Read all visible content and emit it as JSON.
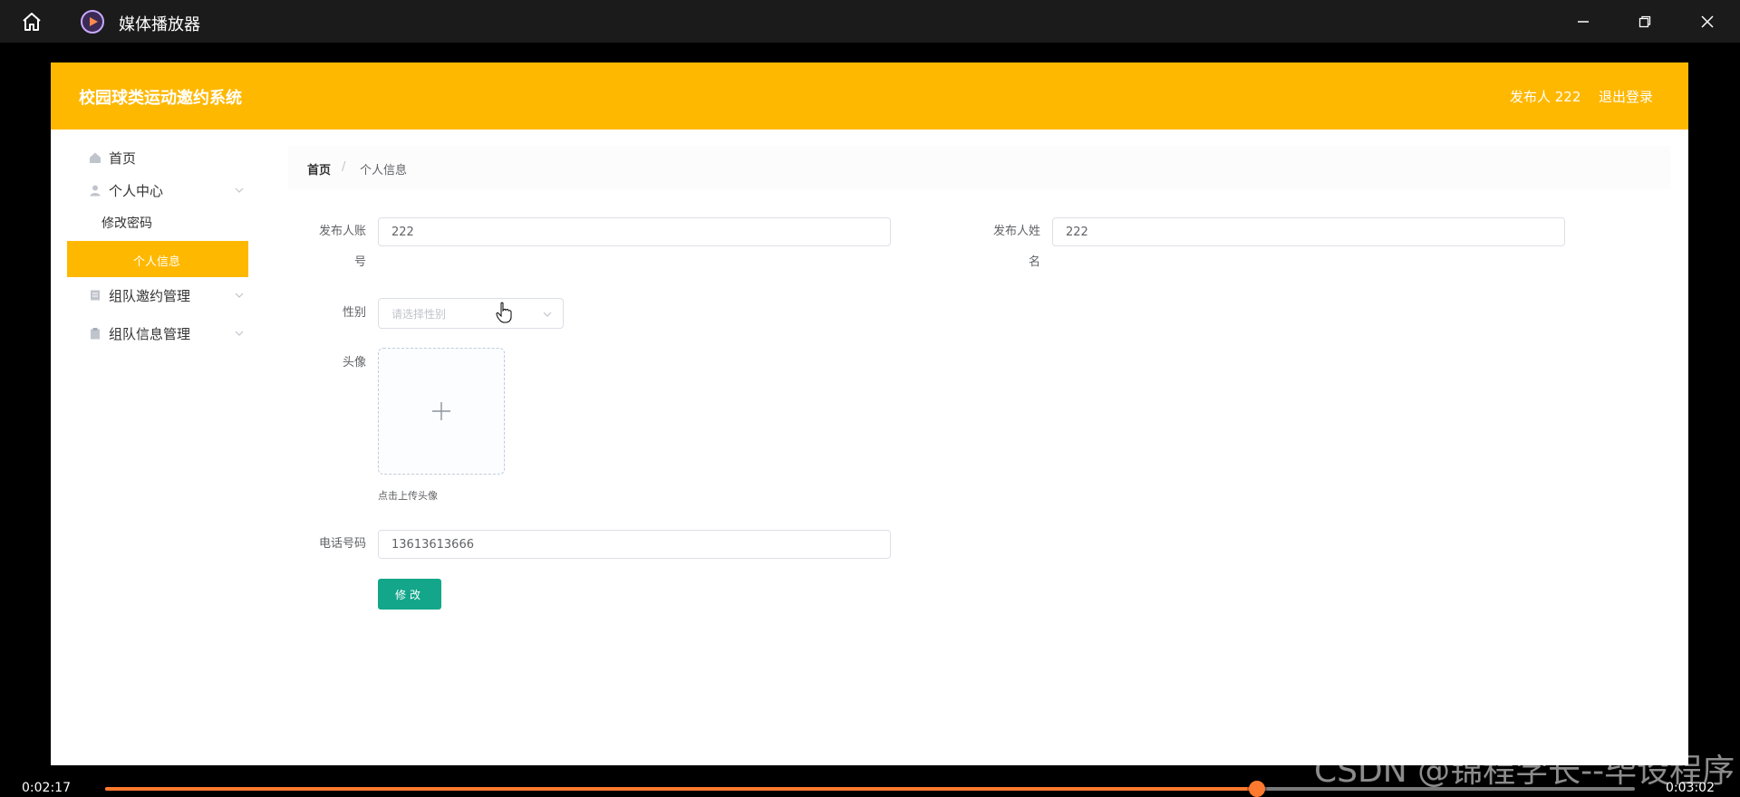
{
  "player": {
    "title": "媒体播放器",
    "time_current": "0:02:17",
    "time_total": "0:03:02",
    "progress": 0.7527,
    "accent": "#ff7a2e",
    "watermark": "CSDN @锦程学长--毕设程序"
  },
  "app": {
    "system_title": "校园球类运动邀约系统",
    "user_label": "发布人 222",
    "logout_label": "退出登录",
    "header_color": "#ffb800"
  },
  "sidebar": {
    "items": [
      {
        "label": "首页",
        "icon": "home-icon"
      },
      {
        "label": "个人中心",
        "icon": "user-icon"
      },
      {
        "label": "修改密码"
      },
      {
        "label": "个人信息"
      },
      {
        "label": "组队邀约管理",
        "icon": "document-icon"
      },
      {
        "label": "组队信息管理",
        "icon": "clipboard-icon"
      }
    ]
  },
  "breadcrumb": {
    "home": "首页",
    "separator": "/",
    "current": "个人信息"
  },
  "form": {
    "account_label_line1": "发布人账",
    "account_label_line2": "号",
    "account_value": "222",
    "name_label_line1": "发布人姓",
    "name_label_line2": "名",
    "name_value": "222",
    "gender_label": "性别",
    "gender_placeholder": "请选择性别",
    "avatar_label": "头像",
    "avatar_hint": "点击上传头像",
    "phone_label": "电话号码",
    "phone_value": "13613613666",
    "submit_label": "修改",
    "submit_color": "#13a68a"
  }
}
